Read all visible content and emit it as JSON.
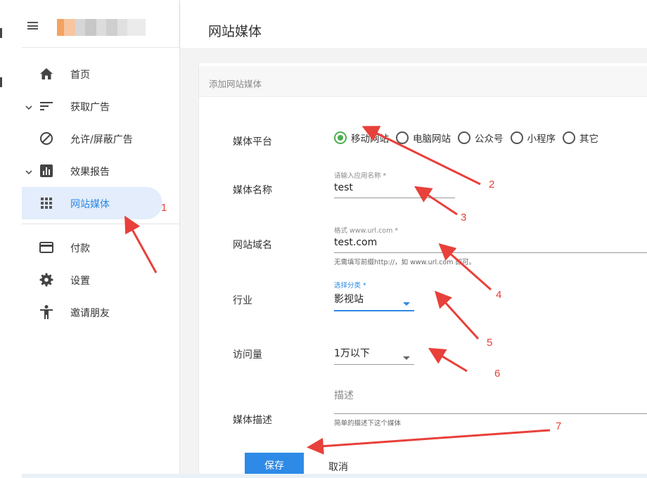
{
  "header": {
    "title": "网站媒体"
  },
  "sidebar": {
    "items": [
      {
        "label": "首页",
        "icon": "home-icon"
      },
      {
        "label": "获取广告",
        "icon": "sort-lines-icon",
        "expandable": true
      },
      {
        "label": "允许/屏蔽广告",
        "icon": "block-icon"
      },
      {
        "label": "效果报告",
        "icon": "bar-chart-icon",
        "expandable": true
      },
      {
        "label": "网站媒体",
        "icon": "grid-icon",
        "active": true
      },
      {
        "label": "付款",
        "icon": "credit-card-icon"
      },
      {
        "label": "设置",
        "icon": "gear-icon"
      },
      {
        "label": "邀请朋友",
        "icon": "person-icon"
      }
    ]
  },
  "form": {
    "section_title": "添加网站媒体",
    "platform": {
      "label": "媒体平台",
      "options": [
        "移动网站",
        "电脑网站",
        "公众号",
        "小程序",
        "其它"
      ],
      "selected": "移动网站"
    },
    "name": {
      "label": "媒体名称",
      "float_label": "请输入应用名称 *",
      "value": "test"
    },
    "domain": {
      "label": "网站域名",
      "float_label": "格式 www.url.com *",
      "value": "test.com",
      "hint": "无需填写前缀http://，如 www.url.com 即可。"
    },
    "industry": {
      "label": "行业",
      "float_label": "选择分类 *",
      "value": "影视站"
    },
    "traffic": {
      "label": "访问量",
      "value": "1万以下"
    },
    "description": {
      "label": "媒体描述",
      "placeholder": "描述",
      "hint": "简单的描述下这个媒体"
    },
    "save_label": "保存",
    "cancel_label": "取消"
  },
  "annotations": [
    "1",
    "2",
    "3",
    "4",
    "5",
    "6",
    "7"
  ],
  "colors": {
    "accent": "#2d89e5",
    "radio_checked": "#4caf50",
    "annotation": "#e8403a"
  }
}
